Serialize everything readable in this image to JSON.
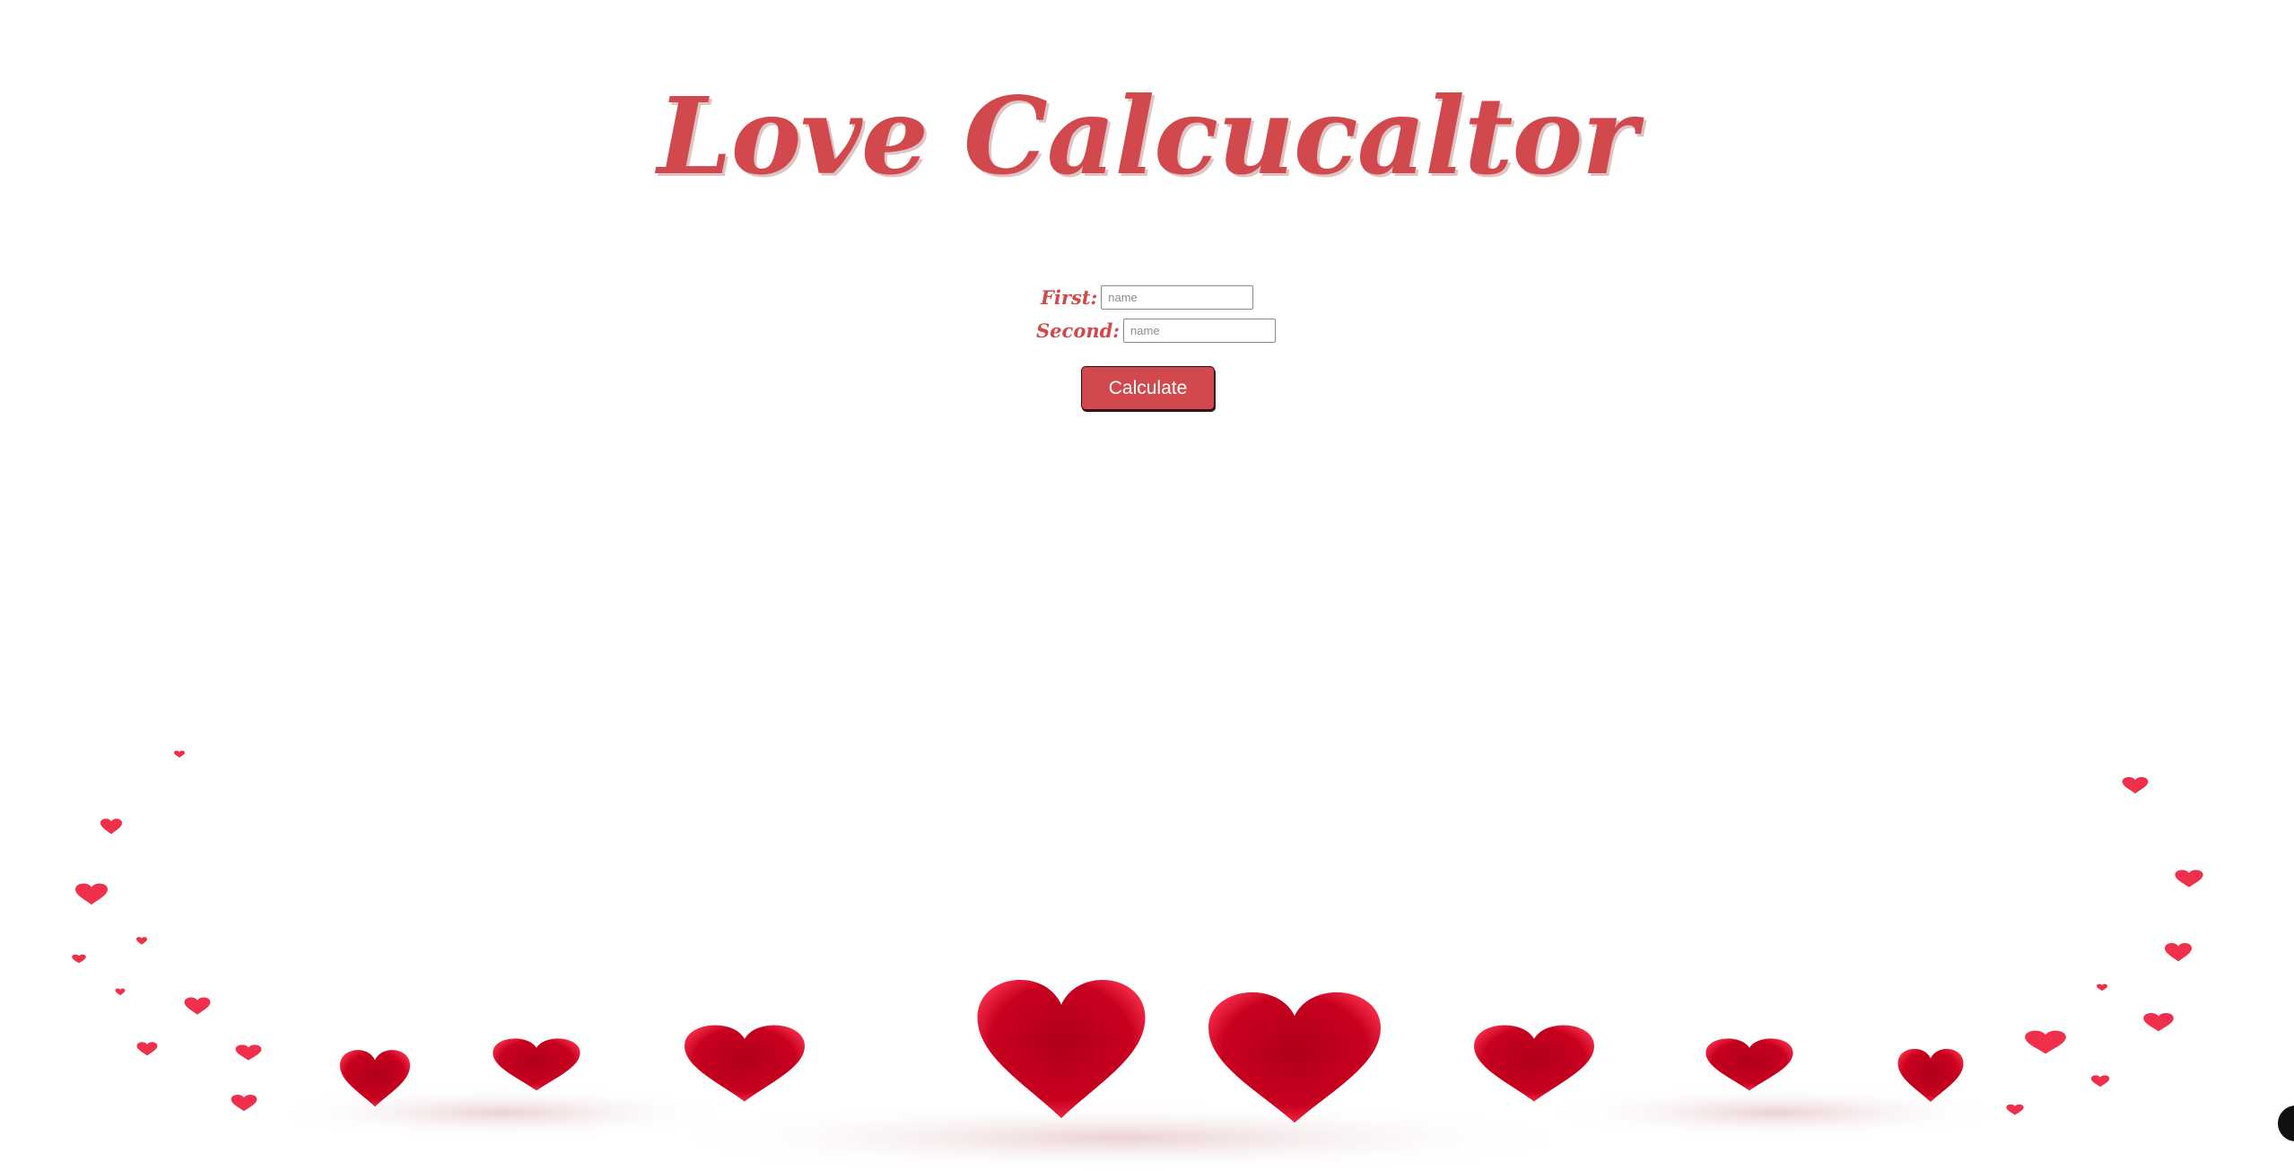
{
  "page": {
    "title": "Love Calcucaltor"
  },
  "form": {
    "first_label": "First:",
    "first_placeholder": "name",
    "first_value": "",
    "second_label": "Second:",
    "second_placeholder": "name",
    "second_value": "",
    "calculate_label": "Calculate"
  },
  "colors": {
    "accent": "#d1494d",
    "heart_dark": "#b8001c",
    "heart_light": "#ff3c52",
    "heart_small": "#f0304a"
  },
  "icons": {
    "decoration": "hearts-decoration",
    "corner": "circle-icon"
  }
}
